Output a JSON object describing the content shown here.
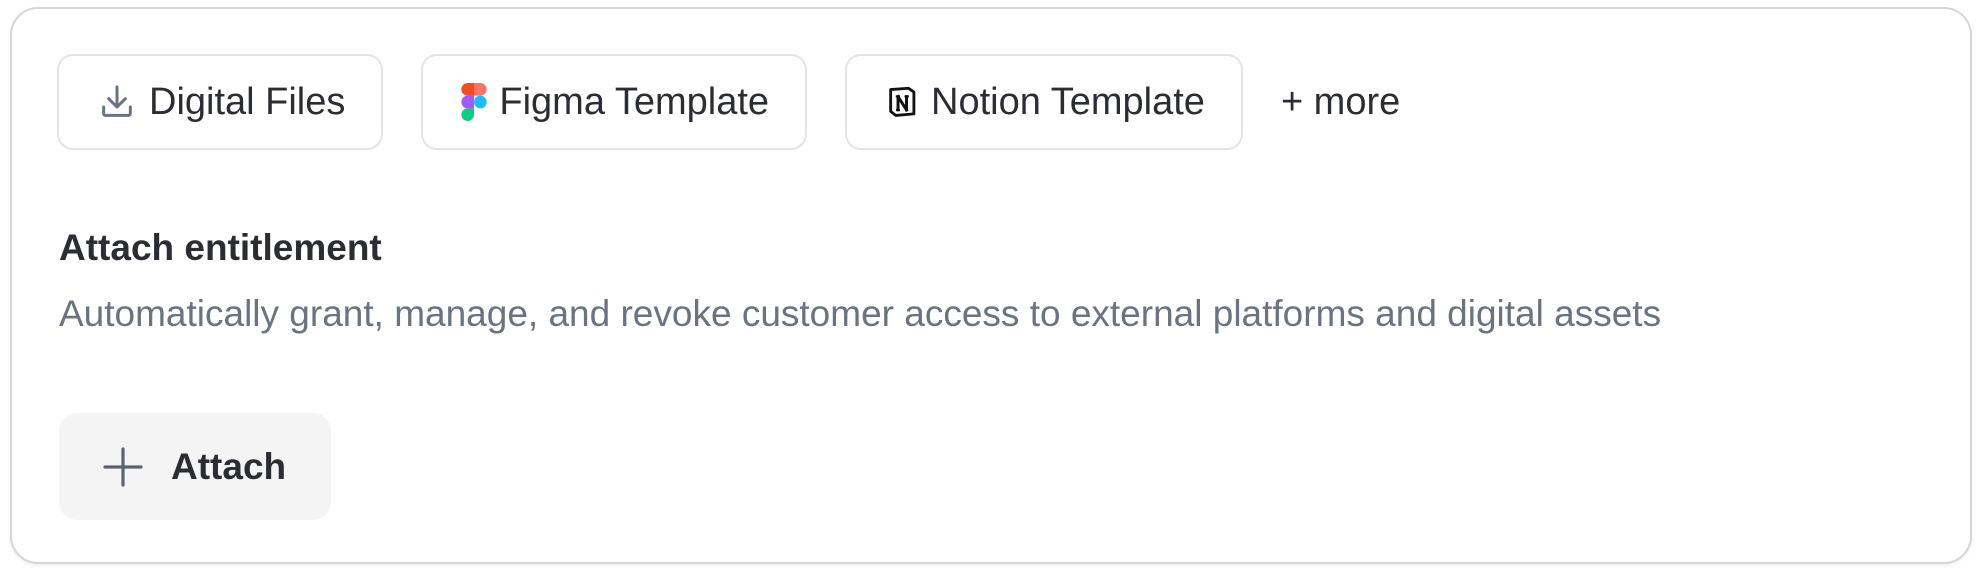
{
  "integrations": {
    "chips": [
      {
        "label": "Digital Files",
        "icon": "download-icon"
      },
      {
        "label": "Figma Template",
        "icon": "figma-logo-icon"
      },
      {
        "label": "Notion Template",
        "icon": "notion-logo-icon"
      }
    ],
    "more_label": "+ more"
  },
  "entitlement": {
    "title": "Attach entitlement",
    "description": "Automatically grant, manage, and revoke customer access to external platforms and digital assets",
    "attach_label": "Attach",
    "attach_icon": "plus-icon"
  },
  "colors": {
    "text_primary": "#2b2d33",
    "text_secondary": "#6b7280",
    "border": "#e2e4e8",
    "button_bg": "#f4f4f5"
  }
}
